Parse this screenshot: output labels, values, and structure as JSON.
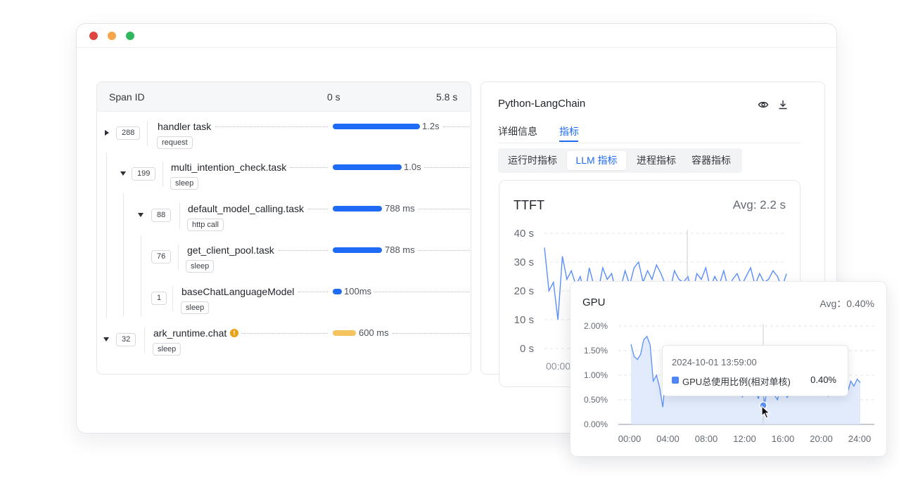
{
  "trace": {
    "header": {
      "span_id": "Span ID",
      "start": "0 s",
      "end": "5.8 s"
    },
    "spans": [
      {
        "count": "288",
        "name": "handler task",
        "tag": "request",
        "duration": "1.2s",
        "expanded": false
      },
      {
        "count": "199",
        "name": "multi_intention_check.task",
        "tag": "sleep",
        "duration": "1.0s",
        "expanded": true
      },
      {
        "count": "88",
        "name": "default_model_calling.task",
        "tag": "http call",
        "duration": "788 ms",
        "expanded": true
      },
      {
        "count": "76",
        "name": "get_client_pool.task",
        "tag": "sleep",
        "duration": "788 ms"
      },
      {
        "count": "1",
        "name": "baseChatLanguageModel",
        "tag": "sleep",
        "duration": "100ms"
      },
      {
        "count": "32",
        "name": "ark_runtime.chat",
        "tag": "sleep",
        "duration": "600 ms",
        "expanded": true,
        "warning": true
      }
    ]
  },
  "panel": {
    "title": "Python-LangChain",
    "tabs": [
      "详细信息",
      "指标"
    ],
    "active_tab": "指标",
    "subtabs": [
      "运行时指标",
      "LLM 指标",
      "进程指标",
      "容器指标"
    ],
    "active_subtab": "LLM 指标"
  },
  "ttft": {
    "title": "TTFT",
    "avg": "Avg: 2.2 s",
    "x_first_label": "00:00"
  },
  "gpu": {
    "title": "GPU",
    "avg": "Avg：0.40%",
    "tooltip": {
      "time": "2024-10-01  13:59:00",
      "series": "GPU总使用比例(相对单核)",
      "value": "0.40%"
    }
  },
  "colors": {
    "accent": "#1f6bf5",
    "warning_bar": "#f5c460",
    "gpu_line": "#5b8ff9",
    "gpu_fill": "#dce8fb"
  },
  "icons": {
    "view": "eye-icon",
    "download": "download-icon"
  },
  "chart_data": [
    {
      "type": "line",
      "title": "TTFT",
      "xlabel": "",
      "ylabel": "",
      "y_ticks": [
        "40 s",
        "30 s",
        "20 s",
        "10 s",
        "0 s"
      ],
      "ylim": [
        0,
        40
      ],
      "x": [
        0,
        0.5,
        1,
        1.5,
        2,
        2.5,
        3,
        3.5,
        4,
        4.5,
        5,
        5.5,
        6,
        6.5,
        7,
        7.5,
        8,
        8.5,
        9,
        9.5,
        10,
        10.5,
        11,
        11.5,
        12,
        12.5,
        13,
        13.5,
        14,
        14.5,
        15,
        15.5,
        16,
        16.5,
        17,
        17.5,
        18,
        18.5,
        19,
        19.5,
        20,
        20.5,
        21,
        21.5,
        22,
        22.5,
        23,
        23.5,
        24,
        24.5,
        25,
        25.5,
        26,
        26.5,
        27
      ],
      "values": [
        35,
        20,
        23,
        10,
        32,
        24,
        27,
        22,
        25,
        18,
        28,
        22,
        20,
        28,
        24,
        26,
        19,
        21,
        27,
        22,
        28,
        30,
        23,
        27,
        24,
        29,
        26,
        22,
        20,
        27,
        24,
        23,
        25,
        19,
        26,
        24,
        28,
        21,
        25,
        22,
        27,
        21,
        24,
        26,
        22,
        25,
        28,
        22,
        26,
        23,
        24,
        27,
        25,
        21,
        26
      ]
    },
    {
      "type": "area",
      "title": "GPU",
      "xlabel": "",
      "ylabel": "",
      "y_ticks": [
        "2.00%",
        "1.50%",
        "1.00%",
        "0.50%",
        "0.00%"
      ],
      "x_ticks": [
        "00:00",
        "04:00",
        "08:00",
        "12:00",
        "16:00",
        "20:00",
        "24:00"
      ],
      "ylim": [
        0,
        2
      ],
      "series": [
        {
          "x": [
            0,
            0.33,
            0.67,
            1,
            1.33,
            1.67,
            2,
            2.33,
            2.67,
            3,
            3.33,
            3.67,
            4,
            4.33,
            4.67,
            5,
            5.33,
            5.67,
            6,
            6.33,
            6.67,
            7,
            7.33,
            7.67,
            8,
            8.33,
            8.67,
            9,
            9.33,
            9.67,
            10,
            10.33,
            10.67,
            11,
            11.33,
            11.67,
            12,
            12.33,
            12.67,
            13,
            13.33,
            13.67,
            14,
            14.33,
            14.67,
            15,
            15.33,
            15.67,
            16,
            16.33,
            16.67,
            17,
            17.33,
            17.67,
            18,
            18.33,
            18.67,
            19,
            19.33,
            19.67,
            20,
            20.33,
            20.67,
            21,
            21.33,
            21.67,
            22,
            22.33,
            22.67,
            23,
            23.33,
            23.67,
            24
          ],
          "values": [
            1.63,
            1.38,
            1.32,
            1.42,
            1.72,
            1.79,
            1.62,
            0.88,
            1.0,
            0.75,
            0.35,
            1.07,
            1.3,
            1.18,
            0.96,
            1.12,
            0.86,
            0.98,
            0.94,
            0.72,
            0.88,
            0.98,
            0.84,
            1.05,
            0.62,
            0.75,
            0.92,
            0.68,
            0.8,
            1.0,
            0.62,
            0.9,
            0.72,
            0.94,
            0.8,
            0.55,
            0.86,
            0.74,
            0.98,
            0.72,
            0.52,
            0.86,
            0.4,
            0.9,
            0.72,
            0.6,
            0.5,
            0.8,
            0.72,
            0.55,
            0.62,
            0.95,
            0.68,
            0.82,
            0.98,
            0.62,
            0.8,
            0.72,
            1.0,
            0.6,
            0.75,
            0.92,
            0.58,
            0.72,
            0.64,
            0.86,
            0.7,
            0.94,
            0.66,
            0.88,
            0.78,
            0.92,
            0.85
          ]
        }
      ]
    }
  ]
}
